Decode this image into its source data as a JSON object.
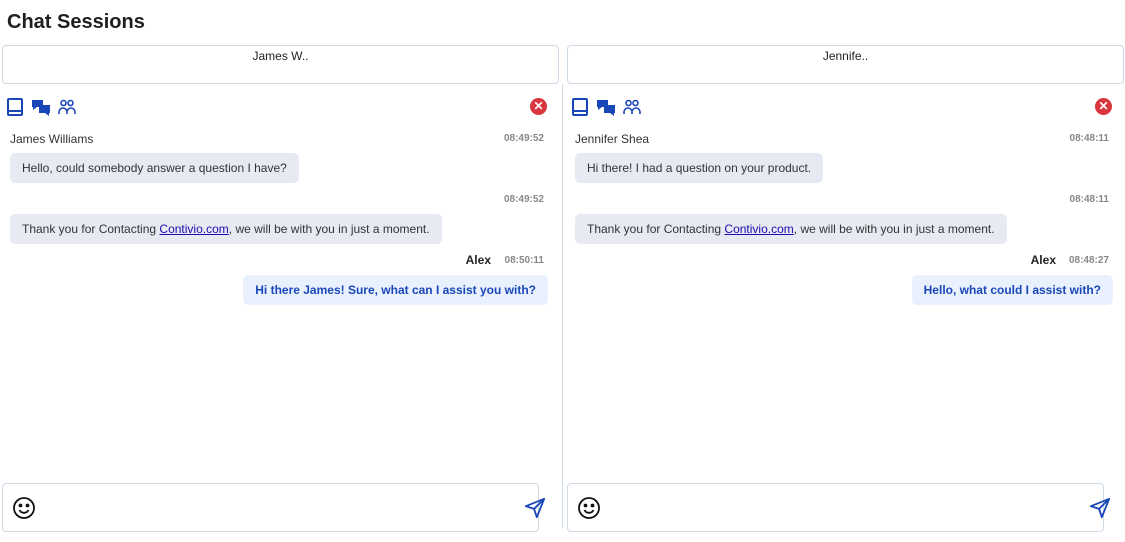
{
  "title": "Chat Sessions",
  "sessions": [
    {
      "tab": "James W..",
      "customer": "James Williams",
      "messages": [
        {
          "time": "08:49:52",
          "text": "Hello, could somebody answer a question I have?"
        },
        {
          "time": "08:49:52",
          "pre": "Thank you for Contacting ",
          "link": "Contivio.com",
          "post": ", we will be with you in just a moment."
        },
        {
          "agent": "Alex",
          "time": "08:50:11",
          "text": "Hi there James! Sure, what can I assist you with?"
        }
      ]
    },
    {
      "tab": "Jennife..",
      "customer": "Jennifer Shea",
      "messages": [
        {
          "time": "08:48:11",
          "text": "Hi there! I had a question on your product."
        },
        {
          "time": "08:48:11",
          "pre": "Thank you for Contacting ",
          "link": "Contivio.com",
          "post": ", we will be with you in just a moment."
        },
        {
          "agent": "Alex",
          "time": "08:48:27",
          "text": "Hello, what could I assist with?"
        }
      ]
    }
  ],
  "close_symbol": "✕",
  "colors": {
    "accent": "#1a47b8",
    "close": "#d9363e",
    "bubble": "#e8eaf3",
    "agent_bubble": "#e8f1fd"
  }
}
